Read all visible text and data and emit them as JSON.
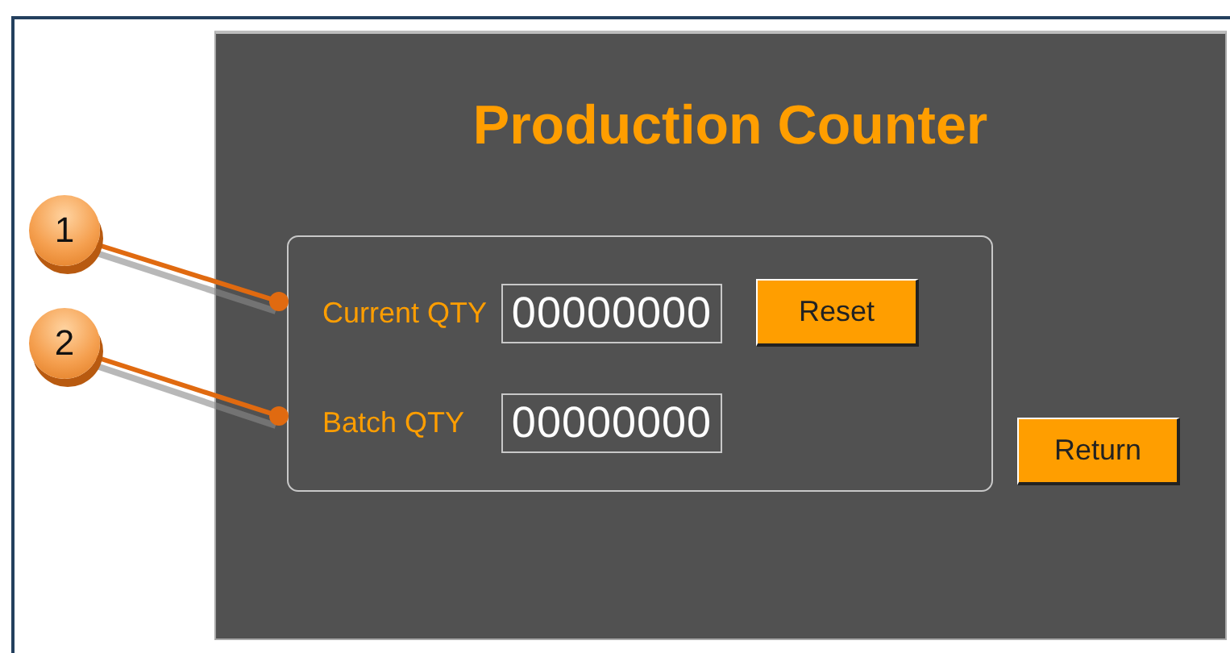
{
  "title": "Production Counter",
  "counters": [
    {
      "label": "Current QTY",
      "value": "00000000",
      "button": "Reset"
    },
    {
      "label": "Batch QTY",
      "value": "00000000"
    }
  ],
  "return_button": "Return",
  "callouts": [
    {
      "number": "1"
    },
    {
      "number": "2"
    }
  ]
}
